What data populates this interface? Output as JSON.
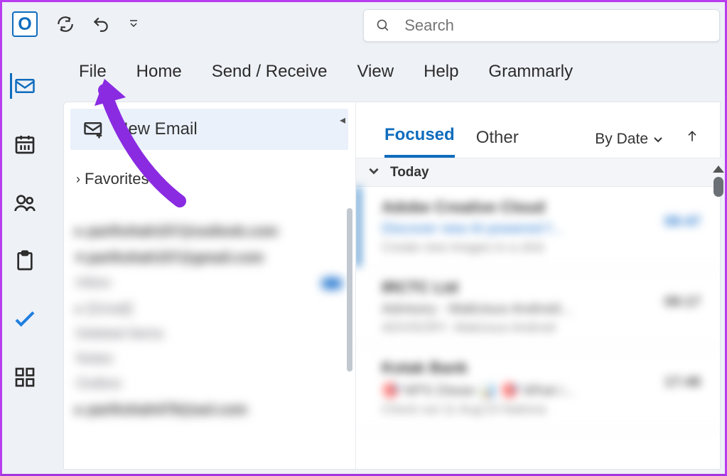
{
  "app_logo_letter": "O",
  "quickbar": {
    "refresh_title": "Send/Receive All Folders",
    "undo_title": "Undo"
  },
  "search": {
    "placeholder": "Search"
  },
  "ribbon": [
    "File",
    "Home",
    "Send / Receive",
    "View",
    "Help",
    "Grammarly"
  ],
  "sidebar_icons": [
    "mail",
    "calendar",
    "people",
    "tasks",
    "todo",
    "apps"
  ],
  "navpane": {
    "new_email_label": "New Email",
    "favorites_label": "Favorites"
  },
  "mail_tabs": {
    "focused": "Focused",
    "other": "Other"
  },
  "sort": {
    "by_date": "By Date"
  },
  "groups": {
    "today": "Today"
  },
  "annotation": {
    "target_tab": "File",
    "color": "#8a2be2"
  }
}
